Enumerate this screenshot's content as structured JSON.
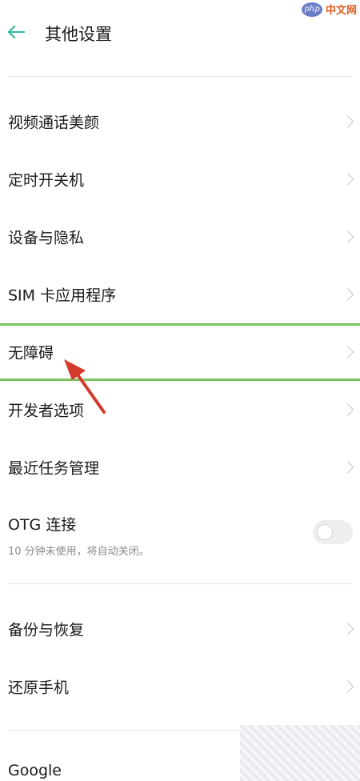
{
  "header": {
    "title": "其他设置",
    "watermark": {
      "logo": "php",
      "text": "中文网"
    }
  },
  "settings": {
    "items": [
      {
        "label": "视频通话美颜"
      },
      {
        "label": "定时开关机"
      },
      {
        "label": "设备与隐私"
      },
      {
        "label": "SIM 卡应用程序"
      },
      {
        "label": "无障碍"
      },
      {
        "label": "开发者选项"
      },
      {
        "label": "最近任务管理"
      }
    ],
    "otg": {
      "label": "OTG 连接",
      "sublabel": "10 分钟未使用，将自动关闭。",
      "enabled": false
    }
  },
  "more": {
    "items": [
      {
        "label": "备份与恢复"
      },
      {
        "label": "还原手机"
      },
      {
        "label": "Google"
      }
    ]
  },
  "colors": {
    "highlight": "#7ec45e",
    "back_arrow": "#3fb8a0",
    "annotation_arrow": "#d33a2c"
  },
  "icons": {
    "back": "back-arrow-icon",
    "chevron": "chevron-right-icon"
  }
}
